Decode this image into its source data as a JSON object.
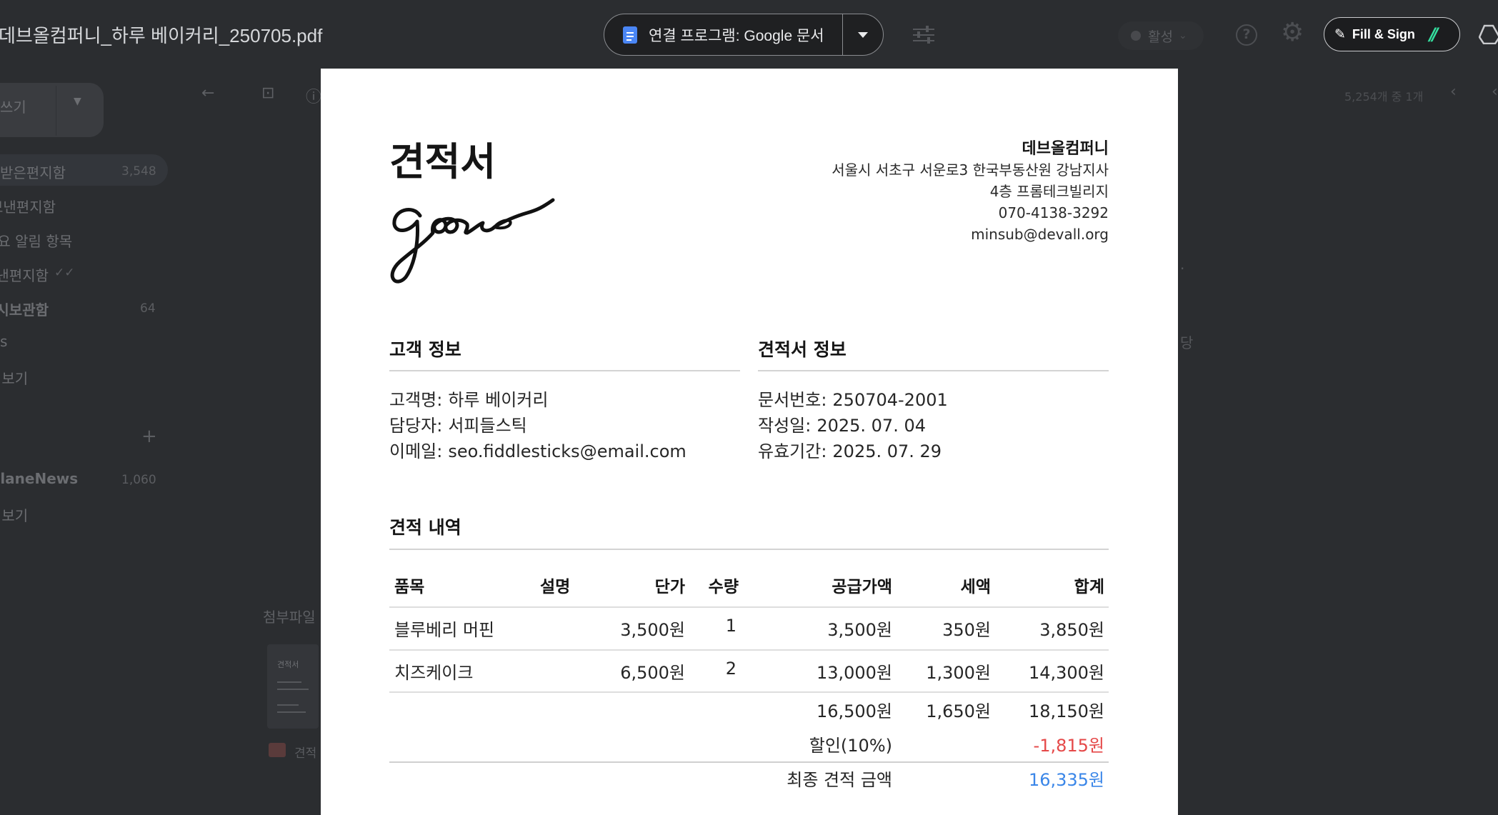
{
  "background": {
    "compose_label": "쓰기",
    "nav": [
      {
        "label": "받은편지함",
        "count": "3,548"
      },
      {
        "label": "보낸편지함",
        "count": ""
      },
      {
        "label": "중요 알림 항목",
        "count": ""
      },
      {
        "label": "보낸편지함",
        "count": ""
      },
      {
        "label": "임시보관함",
        "count": "64"
      },
      {
        "label": "s",
        "count": ""
      },
      {
        "label": "더보기",
        "count": ""
      },
      {
        "label": "planeNews",
        "count": "1,060"
      },
      {
        "label": "더보기",
        "count": ""
      }
    ],
    "pager": "5,254개 중 1개",
    "attachments_title": "첨부파일",
    "attachment_name": "견적"
  },
  "viewer": {
    "file_name": "데브올컴퍼니_하루 베이커리_250705.pdf",
    "open_with_label": "연결 프로그램: Google 문서",
    "status_label": "활성",
    "fill_sign_label": "Fill & Sign"
  },
  "document": {
    "title": "견적서",
    "logo_text": "goose",
    "company": {
      "name": "데브올컴퍼니",
      "address_line1": "서울시 서초구 서운로3 한국부동산원 강남지사",
      "address_line2": "4층 프롬테크빌리지",
      "phone": "070-4138-3292",
      "email": "minsub@devall.org"
    },
    "customer": {
      "heading": "고객 정보",
      "name_label": "고객명:",
      "name": "하루 베이커리",
      "contact_label": "담당자:",
      "contact": "서피들스틱",
      "email_label": "이메일:",
      "email": "seo.fiddlesticks@email.com"
    },
    "quote_info": {
      "heading": "견적서 정보",
      "number_label": "문서번호:",
      "number": "250704-2001",
      "date_label": "작성일:",
      "date": "2025. 07. 04",
      "valid_label": "유효기간:",
      "valid": "2025. 07. 29"
    },
    "items_heading": "견적 내역",
    "columns": [
      "품목",
      "설명",
      "단가",
      "수량",
      "공급가액",
      "세액",
      "합계"
    ],
    "rows": [
      {
        "item": "블루베리 머핀",
        "desc": "",
        "unit_price": "3,500원",
        "qty": "1",
        "supply": "3,500원",
        "tax": "350원",
        "total": "3,850원"
      },
      {
        "item": "치즈케이크",
        "desc": "",
        "unit_price": "6,500원",
        "qty": "2",
        "supply": "13,000원",
        "tax": "1,300원",
        "total": "14,300원"
      }
    ],
    "subtotal": {
      "supply": "16,500원",
      "tax": "1,650원",
      "total": "18,150원"
    },
    "discount_label": "할인(10%)",
    "discount_value": "-1,815원",
    "final_label": "최종 견적 금액",
    "final_value": "16,335원"
  },
  "colors": {
    "discount": "#e54848",
    "final": "#3a86e8",
    "brand_accent": "#35e0a0"
  }
}
